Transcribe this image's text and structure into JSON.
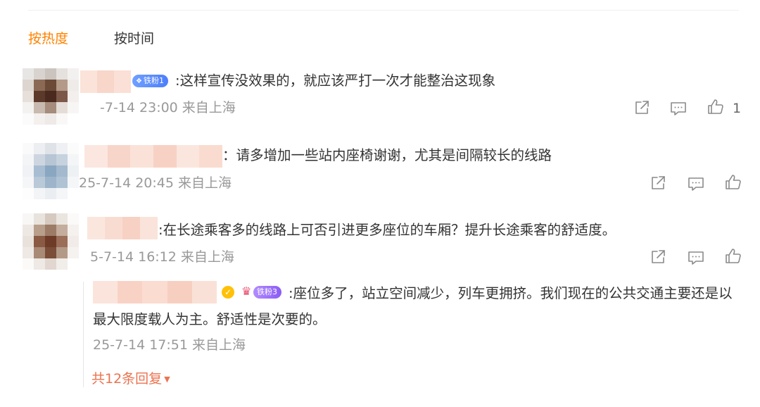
{
  "tabs": {
    "hot": "按热度",
    "time": "按时间"
  },
  "icons": [
    "share-icon",
    "comment-icon",
    "like-icon",
    "verified-icon",
    "crown-icon",
    "caret-down-icon"
  ],
  "colors": {
    "accent": "#ff8200",
    "reply_link": "#eb7350",
    "badge_blue": "#4d7dfc",
    "badge_purple": "#8a5cf5",
    "meta_gray": "#999999"
  },
  "comments": [
    {
      "badge": "铁粉1",
      "text": ":这样宣传没效果的，就应该严打一次才能整治这现象",
      "meta": "-7-14 23:00 来自上海",
      "likes": "1"
    },
    {
      "text": "：请多增加一些站内座椅谢谢，尤其是间隔较长的线路",
      "meta": "25-7-14 20:45 来自上海",
      "likes": ""
    },
    {
      "text": ":在长途乘客多的线路上可否引进更多座位的车厢？提升长途乘客的舒适度。",
      "meta": "5-7-14 16:12 来自上海",
      "likes": ""
    }
  ],
  "reply": {
    "badge": "铁粉3",
    "text": ":座位多了，站立空间减少，列车更拥挤。我们现在的公共交通主要还是以最大限度载人为主。舒适性是次要的。",
    "meta": "25-7-14 17:51 来自上海"
  },
  "more_replies": "共12条回复"
}
